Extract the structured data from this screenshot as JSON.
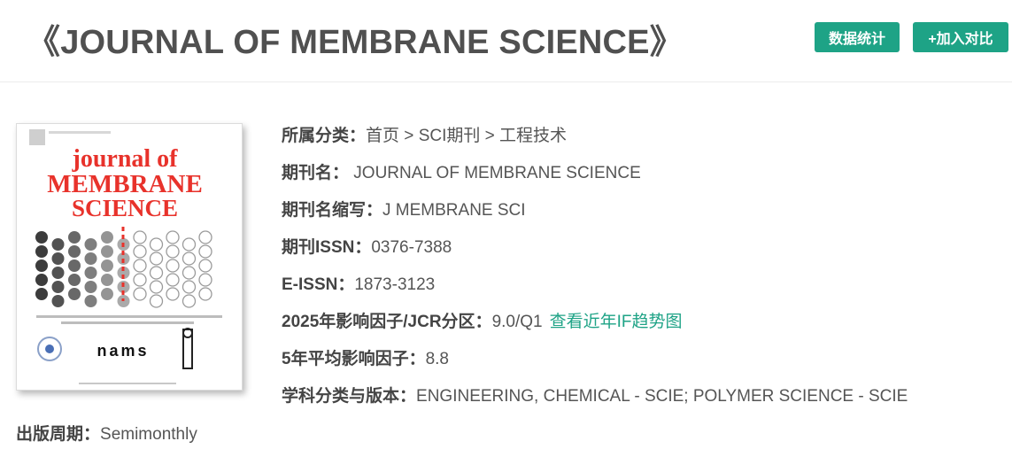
{
  "header": {
    "title": "《JOURNAL OF MEMBRANE SCIENCE》",
    "buttons": {
      "stats_label": "数据统计",
      "compare_label": "+加入对比"
    }
  },
  "cover": {
    "title_line1": "journal of",
    "title_line2": "MEMBRANE",
    "title_line3": "SCIENCE",
    "logo_text": "nams"
  },
  "info": {
    "category": {
      "label": "所属分类：",
      "home": "首页",
      "sep1": " > ",
      "sci": "SCI期刊",
      "sep2": " > ",
      "field": "工程技术"
    },
    "journal_name": {
      "label": "期刊名：",
      "value": " JOURNAL OF MEMBRANE SCIENCE"
    },
    "abbreviation": {
      "label": "期刊名缩写：",
      "value": "J MEMBRANE SCI"
    },
    "issn": {
      "label": "期刊ISSN：",
      "value": "0376-7388"
    },
    "eissn": {
      "label": "E-ISSN：",
      "value": "1873-3123"
    },
    "impact_factor": {
      "label": "2025年影响因子/JCR分区：",
      "value": "9.0/Q1",
      "trend_link": "查看近年IF趋势图"
    },
    "five_year_if": {
      "label": "5年平均影响因子：",
      "value": "8.8"
    },
    "subjects": {
      "label": "学科分类与版本：",
      "value": "ENGINEERING, CHEMICAL - SCIE; POLYMER SCIENCE - SCIE"
    },
    "frequency": {
      "label": "出版周期：",
      "value": "Semimonthly"
    }
  },
  "colors": {
    "accent": "#1ea386",
    "cover_title": "#e8322b"
  }
}
